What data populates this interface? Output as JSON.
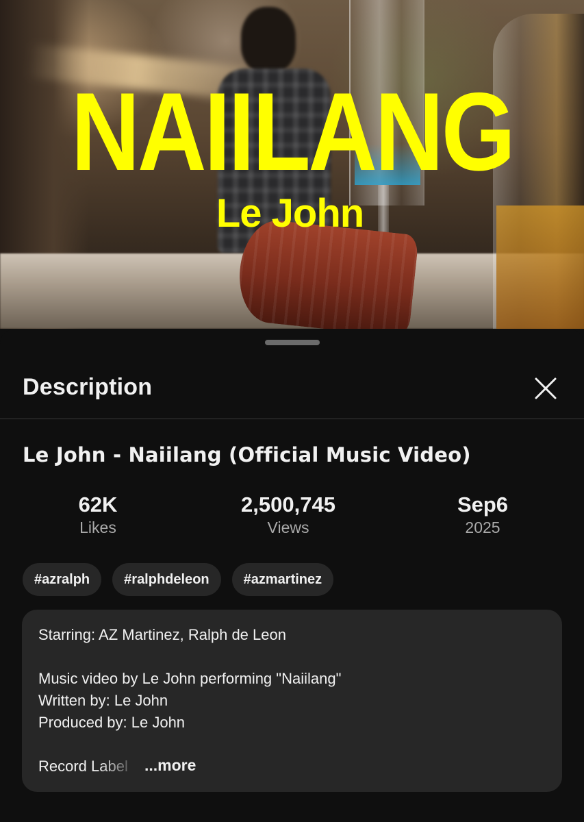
{
  "video": {
    "overlay_title": "NAIILANG",
    "overlay_artist": "Le John"
  },
  "sheet": {
    "title": "Description",
    "close_icon": "close-icon"
  },
  "details": {
    "video_title": "Le John - Naiilang (Official Music Video)",
    "stats": {
      "likes_value": "62K",
      "likes_label": "Likes",
      "views_value": "2,500,745",
      "views_label": "Views",
      "date_value": "Sep6",
      "date_year": "2025"
    },
    "hashtags": [
      "#azralph",
      "#ralphdeleon",
      "#azmartinez"
    ]
  },
  "description": {
    "lines": [
      "Starring: AZ Martinez, Ralph de Leon",
      "Music video by Le John performing \"Naiilang\"",
      "Written by: Le John",
      "Produced by: Le John",
      "Record Label"
    ],
    "more_label": "...more"
  },
  "colors": {
    "background": "#0f0f0f",
    "chip": "#272727",
    "overlay_text": "#ffff00",
    "secondary_text": "#aaaaaa"
  }
}
